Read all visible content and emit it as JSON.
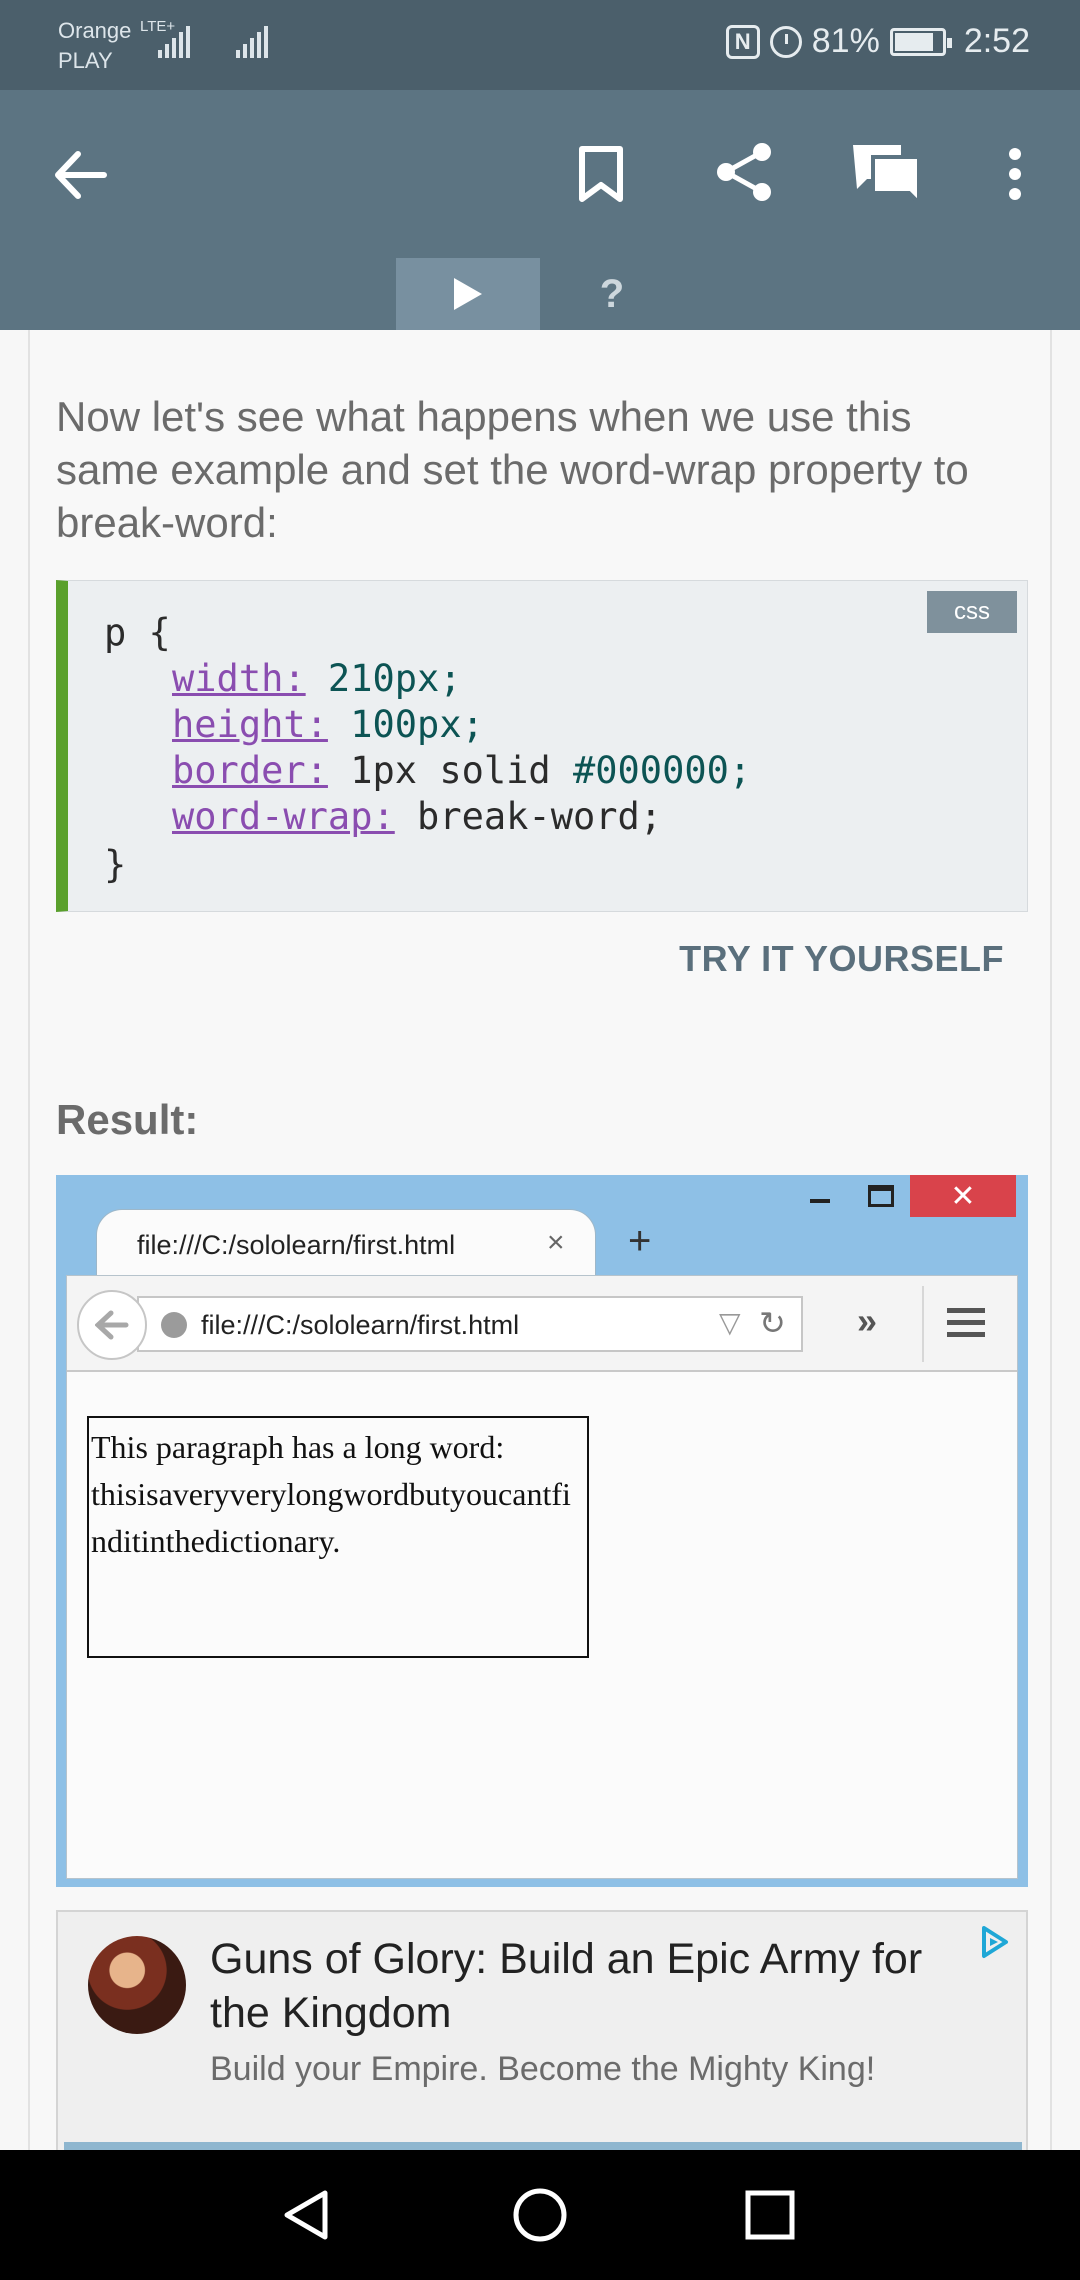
{
  "status_bar": {
    "carrier_line1": "Orange",
    "carrier_line2": "PLAY",
    "network": "LTE+",
    "battery_percent": "81%",
    "time": "2:52"
  },
  "app_bar": {
    "icons": [
      "back-arrow-icon",
      "bookmark-icon",
      "share-icon",
      "comments-icon",
      "more-vert-icon"
    ]
  },
  "tabs": {
    "help_label": "?"
  },
  "lesson": {
    "intro": "Now let's see what happens when we use this same example and set the word-wrap property to break-word:",
    "code_lang": "css",
    "code": {
      "selector_open": "p {",
      "l1_prop": "width:",
      "l1_val": " 210px;",
      "l2_prop": "height:",
      "l2_val": " 100px;",
      "l3_prop": "border:",
      "l3_val_a": " 1px solid ",
      "l3_val_b": "#000000;",
      "l4_prop": "word-wrap:",
      "l4_val": " break-word;",
      "close": "}"
    },
    "try_label": "TRY IT YOURSELF",
    "result_label": "Result:"
  },
  "result_browser": {
    "tab_title": "file:///C:/sololearn/first.html",
    "url": "file:///C:/sololearn/first.html",
    "close_glyph": "✕",
    "tab_close_glyph": "×",
    "new_tab_glyph": "+",
    "overflow_glyph": "»",
    "paragraph": "This paragraph has a long word: thisisaveryverylongwordbutyoucantfinditinthedictionary."
  },
  "ad": {
    "title": "Guns of Glory: Build an Epic Army for the Kingdom",
    "description": "Build your Empire. Become the Mighty King!"
  },
  "colors": {
    "app_bar": "#5c7482",
    "status_bar": "#4b5f6b",
    "code_accent": "#5aa02c",
    "property": "#8a4db0"
  }
}
